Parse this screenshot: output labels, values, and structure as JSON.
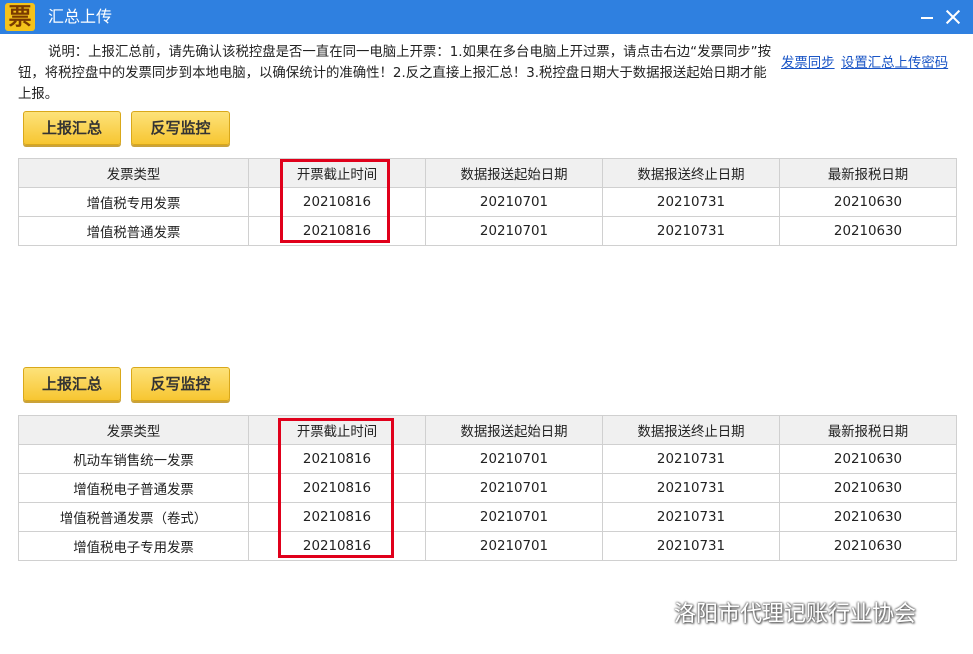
{
  "window": {
    "title": "汇总上传",
    "app_icon_glyph": "票"
  },
  "notice": "说明：上报汇总前，请先确认该税控盘是否一直在同一电脑上开票：1.如果在多台电脑上开过票，请点击右边“发票同步”按钮，将税控盘中的发票同步到本地电脑，以确保统计的准确性！2.反之直接上报汇总！3.税控盘日期大于数据报送起始日期才能上报。",
  "links": {
    "sync": "发票同步",
    "password": "设置汇总上传密码"
  },
  "buttons": {
    "report": "上报汇总",
    "writeback": "反写监控"
  },
  "table_headers": [
    "发票类型",
    "开票截止时间",
    "数据报送起始日期",
    "数据报送终止日期",
    "最新报税日期"
  ],
  "table1": {
    "rows": [
      [
        "增值税专用发票",
        "20210816",
        "20210701",
        "20210731",
        "20210630"
      ],
      [
        "增值税普通发票",
        "20210816",
        "20210701",
        "20210731",
        "20210630"
      ]
    ]
  },
  "table2": {
    "rows": [
      [
        "机动车销售统一发票",
        "20210816",
        "20210701",
        "20210731",
        "20210630"
      ],
      [
        "增值税电子普通发票",
        "20210816",
        "20210701",
        "20210731",
        "20210630"
      ],
      [
        "增值税普通发票（卷式）",
        "20210816",
        "20210701",
        "20210731",
        "20210630"
      ],
      [
        "增值税电子专用发票",
        "20210816",
        "20210701",
        "20210731",
        "20210630"
      ]
    ]
  },
  "watermark": "洛阳市代理记账行业协会",
  "colors": {
    "titlebar": "#2f80e0",
    "button": "#f7c631",
    "highlight": "#e0001b",
    "link": "#1a55c6"
  }
}
